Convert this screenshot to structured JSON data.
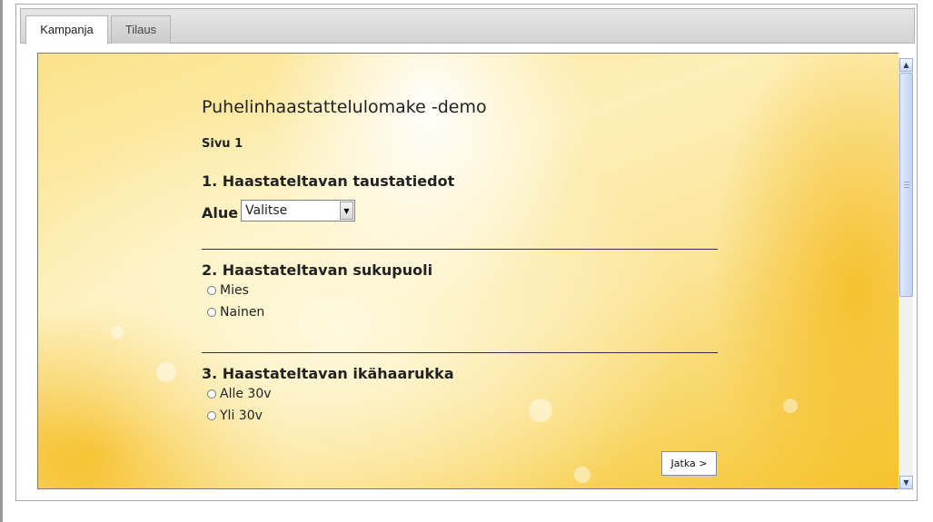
{
  "tabs": [
    {
      "label": "Kampanja",
      "active": true
    },
    {
      "label": "Tilaus",
      "active": false
    }
  ],
  "form": {
    "title": "Puhelinhaastattelulomake -demo",
    "page_label": "Sivu 1",
    "q1": {
      "title": "1. Haastateltavan taustatiedot",
      "field_label": "Alue",
      "select_value": "Valitse"
    },
    "q2": {
      "title": "2. Haastateltavan sukupuoli",
      "options": [
        "Mies",
        "Nainen"
      ]
    },
    "q3": {
      "title": "3. Haastateltavan ikähaarukka",
      "options": [
        "Alle 30v",
        "Yli 30v"
      ]
    },
    "next_button": "Jatka >"
  },
  "icons": {
    "select_arrow": "chevron-down-icon",
    "scroll_up": "scroll-up-icon",
    "scroll_down": "scroll-down-icon"
  },
  "colors": {
    "background_yellow": "#f5c52e",
    "scrollbar_blue": "#c2d4f4"
  }
}
